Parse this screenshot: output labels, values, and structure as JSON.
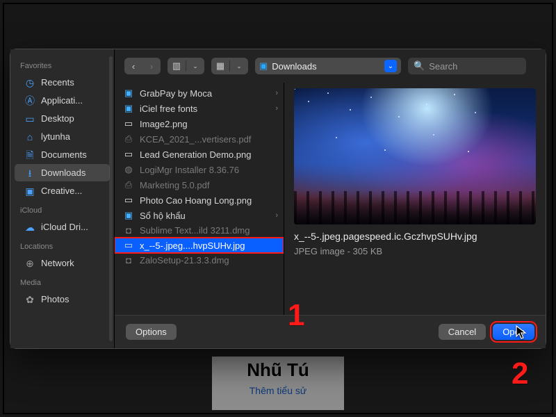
{
  "background": {
    "profile_name": "Nhũ Tú",
    "profile_sub": "Thêm tiểu sử"
  },
  "sidebar": {
    "sections": [
      {
        "title": "Favorites",
        "items": [
          {
            "icon": "clock-icon",
            "label": "Recents"
          },
          {
            "icon": "apps-icon",
            "label": "Applicati..."
          },
          {
            "icon": "desktop-icon",
            "label": "Desktop"
          },
          {
            "icon": "home-icon",
            "label": "lytunha"
          },
          {
            "icon": "doc-icon",
            "label": "Documents"
          },
          {
            "icon": "download-icon",
            "label": "Downloads",
            "selected": true
          },
          {
            "icon": "folder-icon",
            "label": "Creative..."
          }
        ]
      },
      {
        "title": "iCloud",
        "items": [
          {
            "icon": "cloud-icon",
            "label": "iCloud Dri..."
          }
        ]
      },
      {
        "title": "Locations",
        "items": [
          {
            "icon": "globe-icon",
            "label": "Network"
          }
        ]
      },
      {
        "title": "Media",
        "items": [
          {
            "icon": "photos-icon",
            "label": "Photos"
          }
        ]
      }
    ]
  },
  "toolbar": {
    "location": "Downloads",
    "search_placeholder": "Search"
  },
  "files": [
    {
      "icon": "folder",
      "name": "GrabPay by Moca",
      "chev": true
    },
    {
      "icon": "folder",
      "name": "iCiel free fonts",
      "chev": true
    },
    {
      "icon": "image",
      "name": "Image2.png"
    },
    {
      "icon": "pdf",
      "name": "KCEA_2021_...vertisers.pdf",
      "dim": true
    },
    {
      "icon": "image",
      "name": "Lead Generation Demo.png"
    },
    {
      "icon": "pkg",
      "name": "LogiMgr Installer 8.36.76",
      "dim": true
    },
    {
      "icon": "pdf",
      "name": "Marketing 5.0.pdf",
      "dim": true
    },
    {
      "icon": "image",
      "name": "Photo Cao Hoang Long.png"
    },
    {
      "icon": "folder",
      "name": "Sổ hộ khẩu",
      "chev": true
    },
    {
      "icon": "dmg",
      "name": "Sublime Text...ild 3211.dmg",
      "dim": true
    },
    {
      "icon": "image",
      "name": "x_--5-.jpeg....hvpSUHv.jpg",
      "selected": true
    },
    {
      "icon": "dmg",
      "name": "ZaloSetup-21.3.3.dmg",
      "dim": true
    }
  ],
  "preview": {
    "filename": "x_--5-.jpeg.pagespeed.ic.GczhvpSUHv.jpg",
    "meta": "JPEG image - 305 KB"
  },
  "footer": {
    "options": "Options",
    "cancel": "Cancel",
    "open": "Open"
  },
  "callouts": {
    "one": "1",
    "two": "2"
  }
}
